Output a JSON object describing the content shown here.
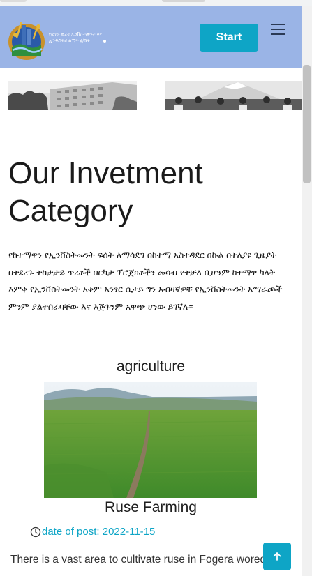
{
  "header": {
    "logo_alt": "Fogera Woreda Investment Office logo",
    "logo_text": "የፎገራ ወረዳ ኢንቨስትመንት እና ኢንዱስትሪ ልማት ፅ/ቤት",
    "start_label": "Start",
    "menu_icon": "hamburger-menu-icon"
  },
  "section": {
    "title": "Our Invetment Category",
    "intro": "የከተማዋን የኢንቨስትመንት ፍሰት ለማሳደግ በከተማ አስተዳደር በኩል በተለያዩ ጊዜያት በተደረጉ ተከታታይ ጥረቶች በርካታ ፕሮጀክቶችን መሳብ የተቻለ ቢሆንም ከተማዋ ካላት እምቅ የኢንቨስትመንት አቅም አንፃር ሲታይ ግን አብዛኛዎቹ የኢንቨስትመንት አማራጮች ምንም ያልተሰራባቸው እና እጅጉንም አዋጭ ሆነው ይገኛሉ፡፡"
  },
  "card": {
    "category": "agriculture",
    "post_title": "Ruse Farming",
    "date_prefix": "date of post:",
    "date": "2022-11-15",
    "description": "There is a vast area to cultivate ruse in Fogera woreda"
  },
  "colors": {
    "header_bg": "#9ab4e6",
    "accent": "#0ea5c6"
  },
  "icons": {
    "clock": "clock-icon",
    "back_to_top": "arrow-up-icon"
  }
}
